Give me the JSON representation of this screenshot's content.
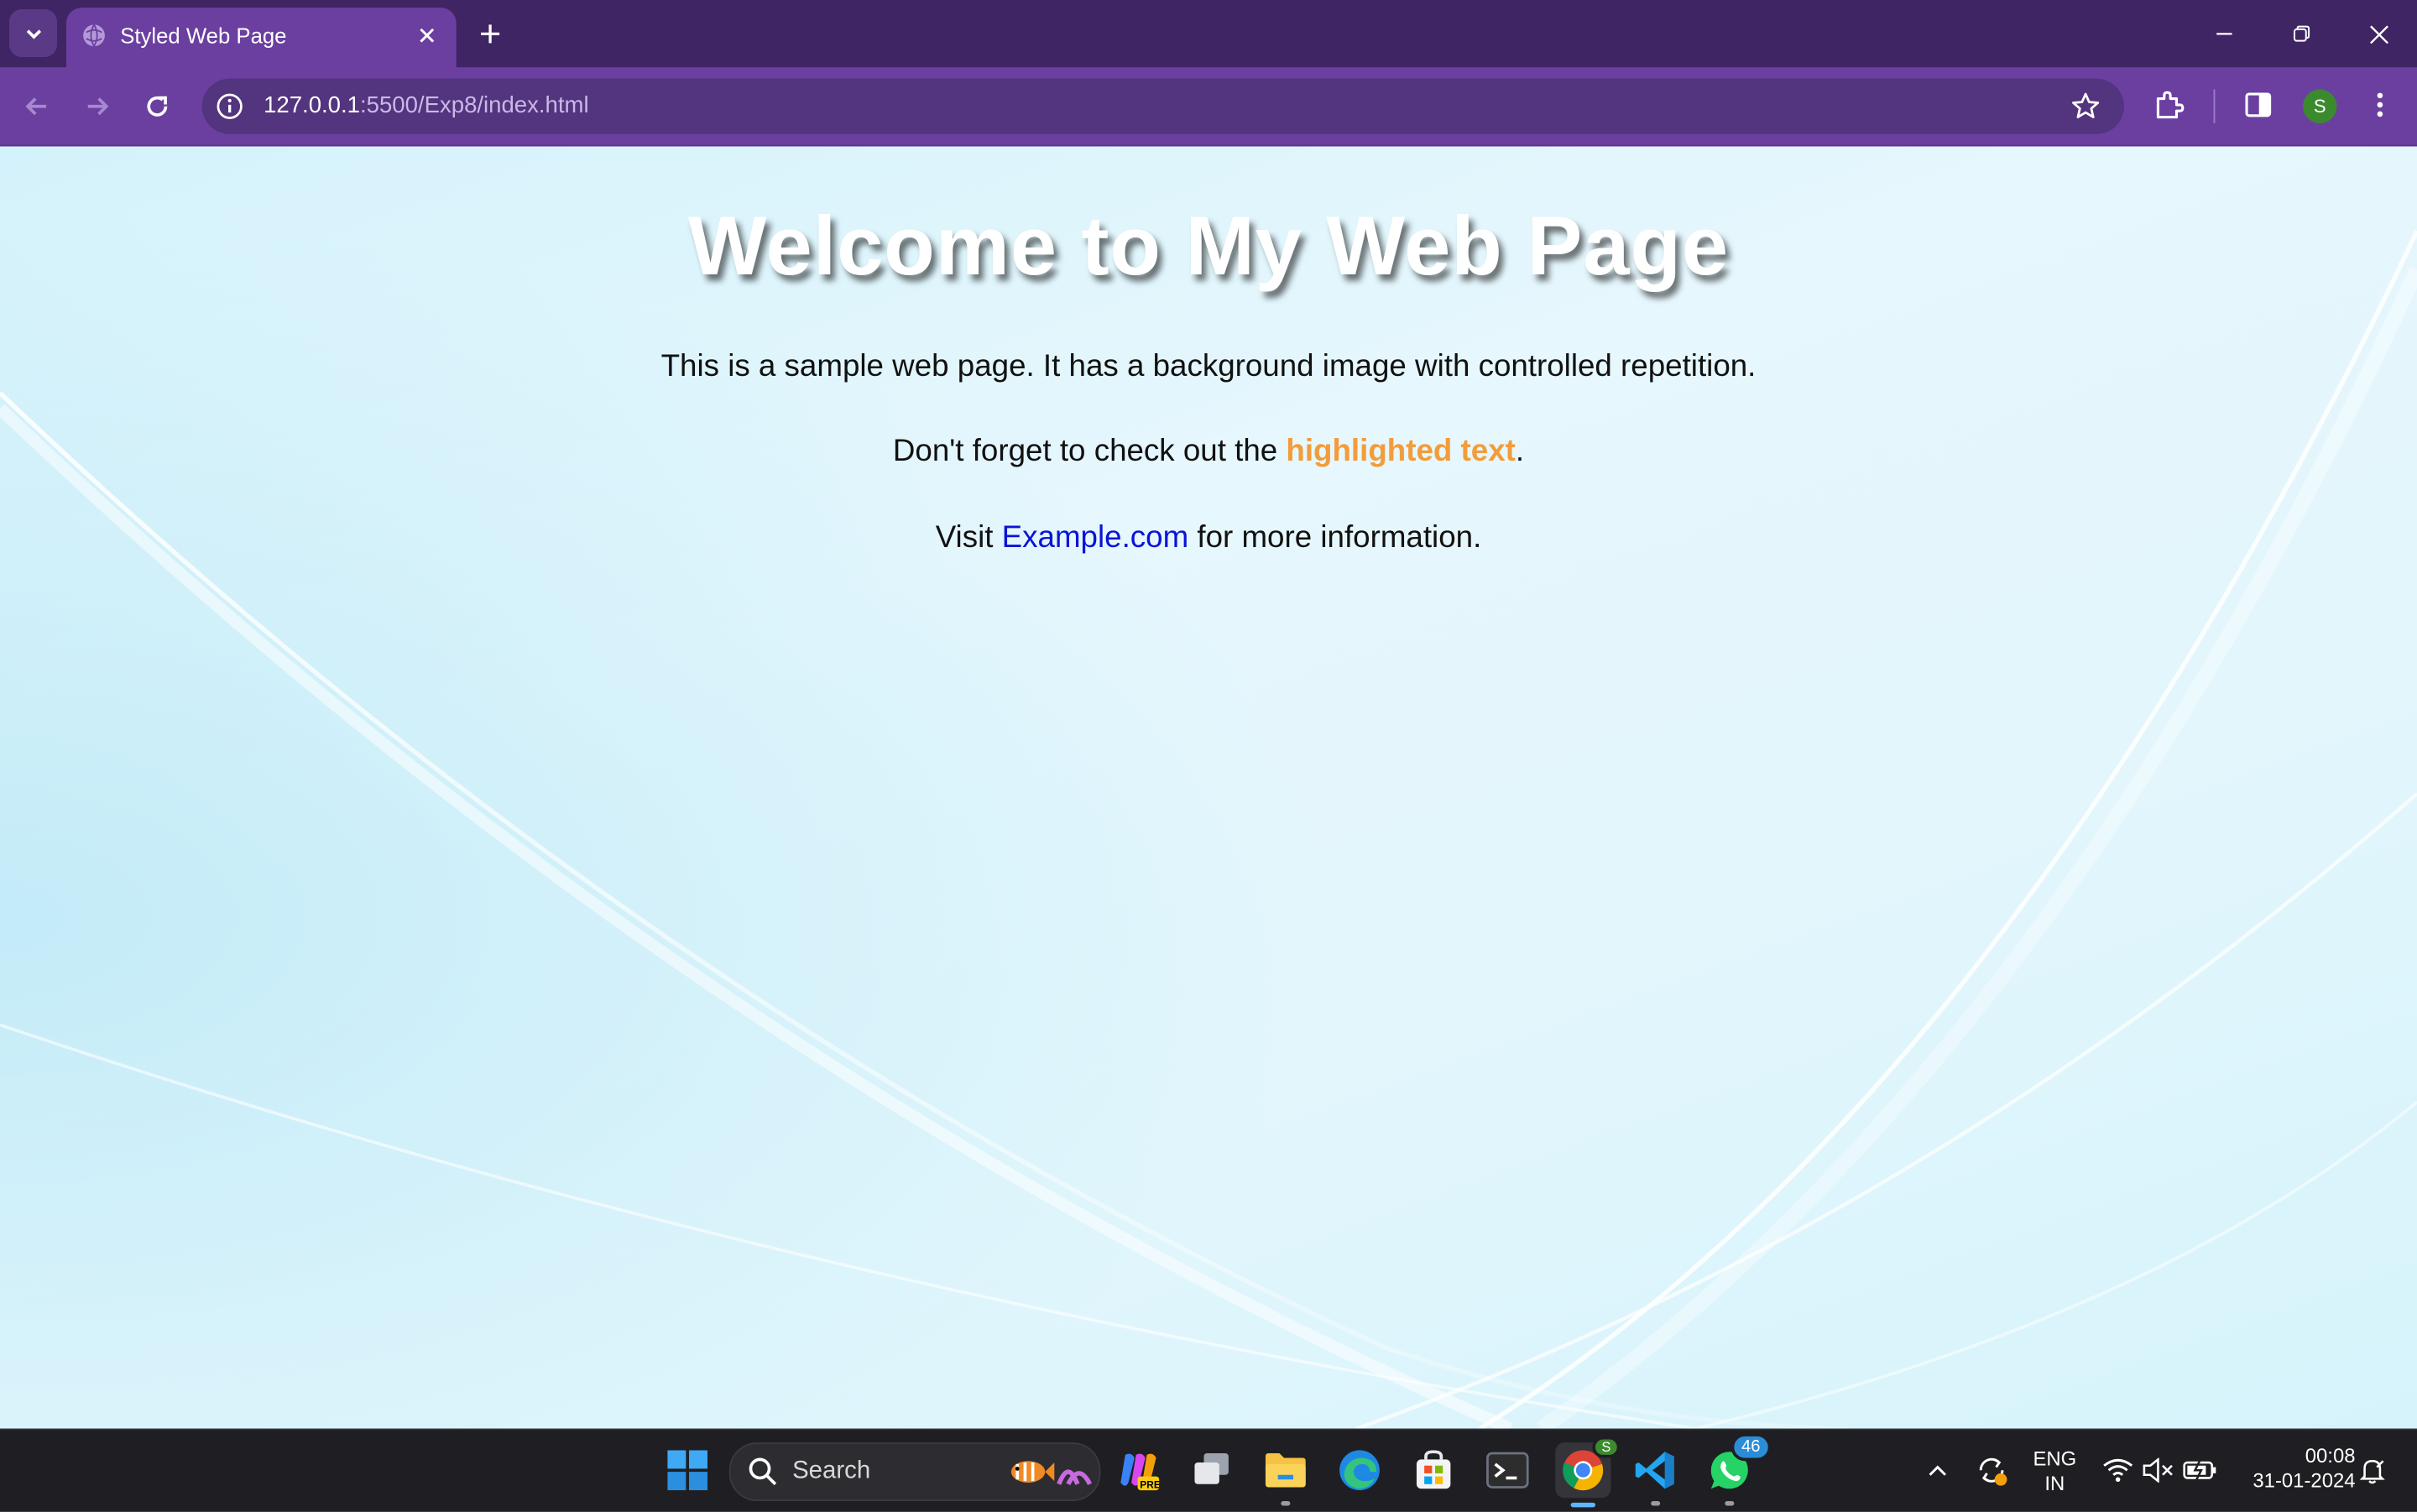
{
  "browser": {
    "tab_title": "Styled Web Page",
    "url_host": "127.0.0.1",
    "url_path": ":5500/Exp8/index.html",
    "profile_initial": "S"
  },
  "page": {
    "heading": "Welcome to My Web Page",
    "para1": "This is a sample web page. It has a background image with controlled repetition.",
    "para2_before": "Don't forget to check out the ",
    "para2_highlight": "highlighted text",
    "para2_after": ".",
    "para3_before": "Visit ",
    "para3_link": "Example.com",
    "para3_after": " for more information."
  },
  "taskbar": {
    "search_label": "Search",
    "whatsapp_badge": "46",
    "chrome_profile_badge": "S",
    "language_line1": "ENG",
    "language_line2": "IN",
    "time": "00:08",
    "date": "31-01-2024"
  },
  "colors": {
    "tabstrip": "#3f2563",
    "toolbar": "#6b3fa0",
    "highlight": "#f39c3a",
    "link": "#0a14d6"
  }
}
